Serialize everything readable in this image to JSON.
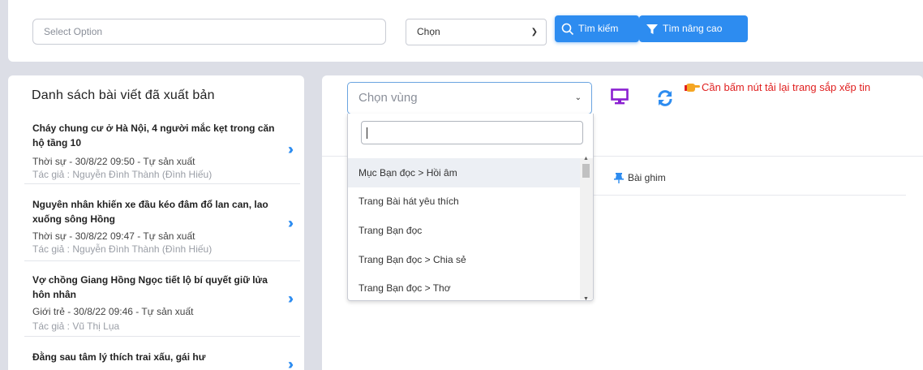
{
  "top": {
    "option_placeholder": "Select Option",
    "select_value": "Chọn",
    "search_label": "Tìm kiếm",
    "advanced_label": "Tìm nâng cao"
  },
  "left": {
    "title": "Danh sách bài viết đã xuất bản",
    "articles": [
      {
        "title": "Cháy chung cư ở Hà Nội, 4 người mắc kẹt trong căn hộ tầng 10",
        "meta": "Thời sự - 30/8/22 09:50 - Tự sản xuất",
        "author": "Tác giả : Nguyễn Đình Thành (Đình Hiếu)"
      },
      {
        "title": "Nguyên nhân khiến xe đầu kéo đâm đổ lan can, lao xuống sông Hồng",
        "meta": "Thời sự - 30/8/22 09:47 - Tự sản xuất",
        "author": "Tác giả : Nguyễn Đình Thành (Đình Hiếu)"
      },
      {
        "title": "Vợ chồng Giang Hồng Ngọc tiết lộ bí quyết giữ lửa hôn nhân",
        "meta": "Giới trẻ - 30/8/22 09:46 - Tự sản xuất",
        "author": "Tác giả : Vũ Thị Lụa"
      },
      {
        "title": "Đằng sau tâm lý thích trai xấu, gái hư",
        "meta": "",
        "author": ""
      }
    ]
  },
  "right": {
    "region_placeholder": "Chọn vùng",
    "reload_note": "Cần bấm nút tải lại trang sắp xếp tin",
    "pinned_label": "Bài ghim"
  },
  "dropdown": {
    "search_value": "",
    "options": [
      "Mục Bạn đọc > Hồi âm",
      "Trang Bài hát yêu thích",
      "Trang Bạn đọc",
      "Trang Bạn đọc > Chia sẻ",
      "Trang Bạn đọc > Thơ"
    ],
    "selected_index": 0
  },
  "colors": {
    "primary": "#2d8cf0",
    "note_red": "#e02020",
    "monitor_purple": "#8a1fd1",
    "hand_yellow": "#f5a623"
  }
}
